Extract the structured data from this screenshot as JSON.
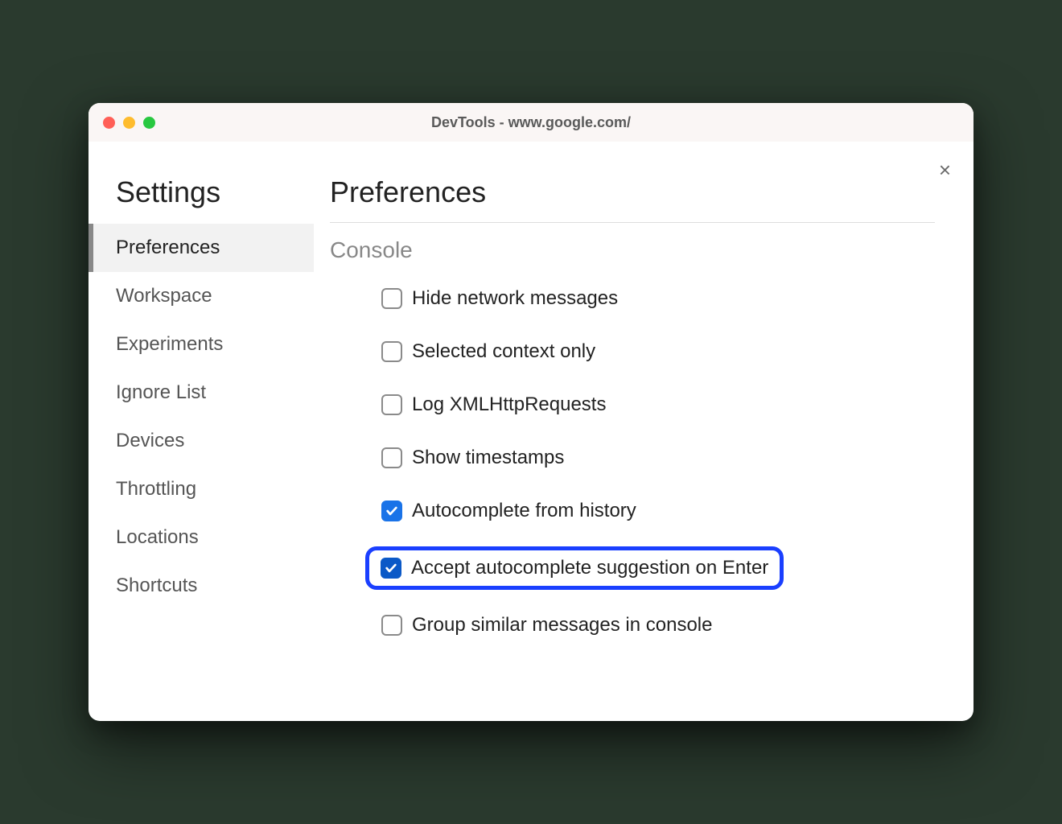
{
  "window": {
    "title": "DevTools - www.google.com/"
  },
  "sidebar": {
    "title": "Settings",
    "items": [
      {
        "label": "Preferences",
        "active": true
      },
      {
        "label": "Workspace",
        "active": false
      },
      {
        "label": "Experiments",
        "active": false
      },
      {
        "label": "Ignore List",
        "active": false
      },
      {
        "label": "Devices",
        "active": false
      },
      {
        "label": "Throttling",
        "active": false
      },
      {
        "label": "Locations",
        "active": false
      },
      {
        "label": "Shortcuts",
        "active": false
      }
    ]
  },
  "main": {
    "title": "Preferences",
    "section": "Console",
    "options": [
      {
        "label": "Hide network messages",
        "checked": false,
        "highlight": false
      },
      {
        "label": "Selected context only",
        "checked": false,
        "highlight": false
      },
      {
        "label": "Log XMLHttpRequests",
        "checked": false,
        "highlight": false
      },
      {
        "label": "Show timestamps",
        "checked": false,
        "highlight": false
      },
      {
        "label": "Autocomplete from history",
        "checked": true,
        "highlight": false
      },
      {
        "label": "Accept autocomplete suggestion on Enter",
        "checked": true,
        "highlight": true
      },
      {
        "label": "Group similar messages in console",
        "checked": false,
        "highlight": false
      }
    ]
  }
}
